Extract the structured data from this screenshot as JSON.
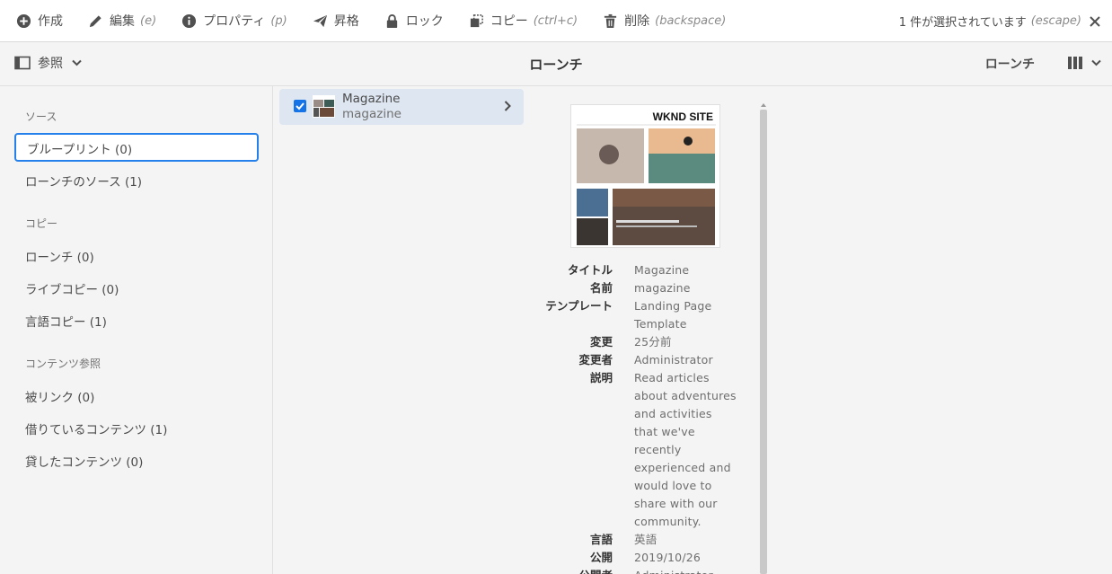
{
  "actionbar": {
    "create": {
      "label": "作成"
    },
    "edit": {
      "label": "編集",
      "shortcut": "(e)"
    },
    "properties": {
      "label": "プロパティ",
      "shortcut": "(p)"
    },
    "promote": {
      "label": "昇格"
    },
    "lock": {
      "label": "ロック"
    },
    "copy": {
      "label": "コピー",
      "shortcut": "(ctrl+c)"
    },
    "delete": {
      "label": "削除",
      "shortcut": "(backspace)"
    },
    "selection": {
      "text": "1 件が選択されています",
      "shortcut": "(escape)"
    }
  },
  "titlebar": {
    "rail_label": "参照",
    "title": "ローンチ",
    "launch_button": "ローンチ"
  },
  "rail": {
    "source_heading": "ソース",
    "blueprint": "ブループリント (0)",
    "launch_source": "ローンチのソース (1)",
    "copy_heading": "コピー",
    "launches": "ローンチ (0)",
    "livecopy": "ライブコピー (0)",
    "langcopy": "言語コピー (1)",
    "content_heading": "コンテンツ参照",
    "backlinks": "被リンク (0)",
    "borrowed": "借りているコンテンツ (1)",
    "lent": "貸したコンテンツ (0)"
  },
  "column": {
    "item": {
      "title": "Magazine",
      "name": "magazine",
      "checked": true
    }
  },
  "preview": {
    "thumb_heading": "WKND SITE",
    "rows": [
      {
        "label": "タイトル",
        "value": "Magazine"
      },
      {
        "label": "名前",
        "value": "magazine"
      },
      {
        "label": "テンプレート",
        "value": "Landing Page Template"
      },
      {
        "label": "変更",
        "value": "25分前"
      },
      {
        "label": "変更者",
        "value": "Administrator"
      },
      {
        "label": "説明",
        "value": "Read articles about adventures and activities that we've recently experienced and would love to share with our community."
      },
      {
        "label": "言語",
        "value": "英語"
      },
      {
        "label": "公開",
        "value": "2019/10/26"
      },
      {
        "label": "公開者",
        "value": "Administrator"
      }
    ]
  },
  "colors": {
    "accent": "#2680eb",
    "selected_row": "#dde6f1",
    "checkbox": "#1473e6"
  }
}
